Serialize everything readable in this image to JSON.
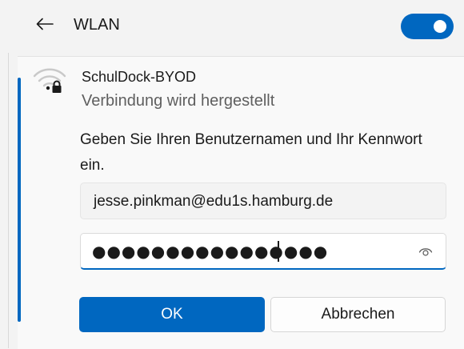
{
  "header": {
    "back_icon": "arrow-left-icon",
    "title": "WLAN",
    "toggle_state": "on",
    "accent_color": "#0067c0"
  },
  "network": {
    "icon": "secured-wifi-icon",
    "name": "SchulDock-BYOD",
    "status": "Verbindung wird hergestellt"
  },
  "login": {
    "prompt": "Geben Sie Ihren Benutzernamen und Ihr Kennwort ein.",
    "username_value": "jesse.pinkman@edu1s.hamburg.de",
    "password_value": "●●●●●●●●●●●●●●●●",
    "reveal_icon": "eye-icon"
  },
  "buttons": {
    "ok_label": "OK",
    "cancel_label": "Abbrechen"
  }
}
